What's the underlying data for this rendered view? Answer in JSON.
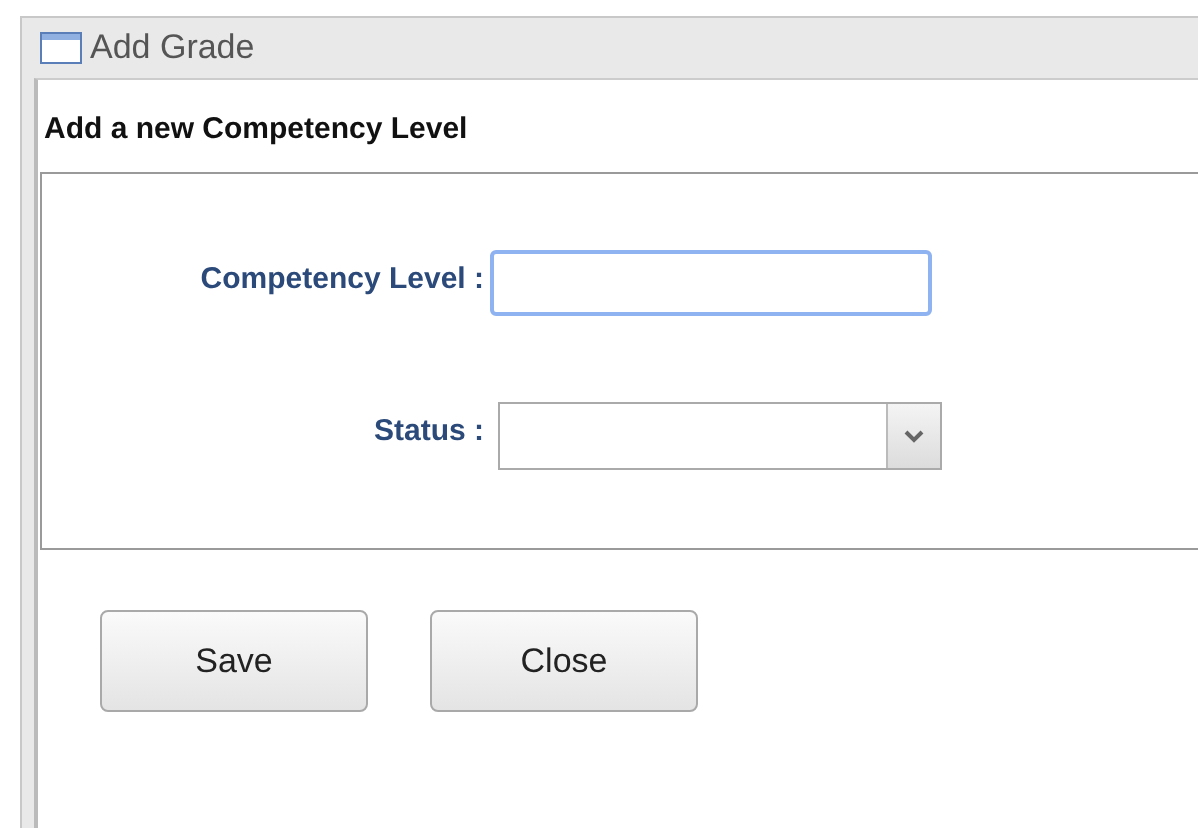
{
  "window": {
    "title": "Add Grade"
  },
  "form": {
    "heading": "Add a new Competency Level",
    "fields": [
      {
        "kind": "text",
        "label": "Competency Level :",
        "focused": true
      },
      {
        "kind": "select",
        "label": "Status :",
        "focused": false
      }
    ]
  },
  "buttons": [
    "Save",
    "Close"
  ]
}
